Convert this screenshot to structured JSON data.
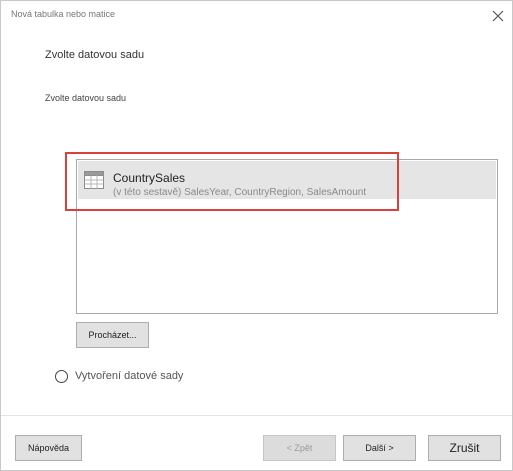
{
  "dialog": {
    "title": "Nová tabulka nebo matice",
    "heading": "Zvolte datovou sadu",
    "subheading": "Zvolte datovou sadu"
  },
  "datasets": [
    {
      "name": "CountrySales",
      "fields": "(v této sestavě) SalesYear, CountryRegion, SalesAmount",
      "icon": "table-icon",
      "selected": true
    }
  ],
  "browse_label": "Procházet...",
  "create_dataset_label": "Vytvoření datové sady",
  "footer": {
    "help_label": "Nápověda",
    "back_label": "< Zpět",
    "next_label": "Další  >",
    "cancel_label": "Zrušit"
  },
  "colors": {
    "highlight": "#d9413f",
    "selected_row": "#e5e5e5"
  }
}
